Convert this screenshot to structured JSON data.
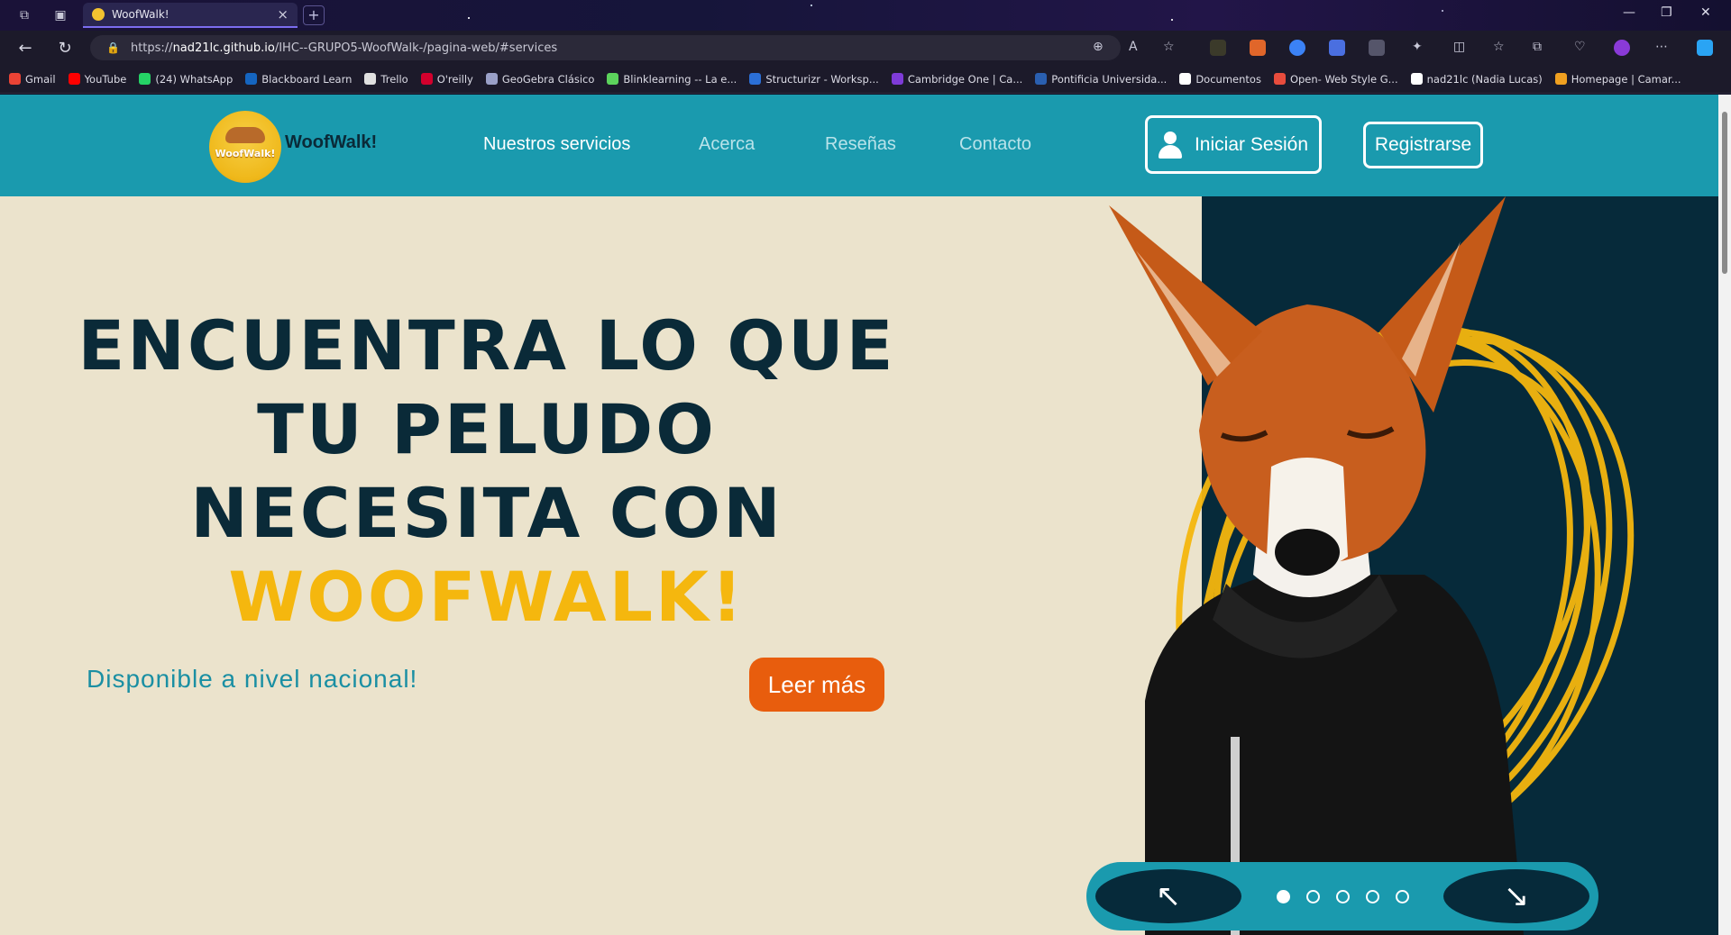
{
  "browser": {
    "tab_title": "WoofWalk!",
    "url_prefix": "https://",
    "url_host": "nad21lc.github.io",
    "url_path": "/IHC--GRUPO5-WoofWalk-/pagina-web/#services"
  },
  "bookmarks": [
    {
      "label": "Gmail",
      "color": "#ea4335"
    },
    {
      "label": "YouTube",
      "color": "#ff0000"
    },
    {
      "label": "(24) WhatsApp",
      "color": "#25d366"
    },
    {
      "label": "Blackboard Learn",
      "color": "#1565c0"
    },
    {
      "label": "Trello",
      "color": "#e0e0e0"
    },
    {
      "label": "O'reilly",
      "color": "#d3002d"
    },
    {
      "label": "GeoGebra Clásico",
      "color": "#9aa0c8"
    },
    {
      "label": "Blinklearning -- La e...",
      "color": "#5cd35c"
    },
    {
      "label": "Structurizr - Worksp...",
      "color": "#2b6fd6"
    },
    {
      "label": "Cambridge One | Ca...",
      "color": "#7e3bd8"
    },
    {
      "label": "Pontificia Universida...",
      "color": "#2a5fb0"
    },
    {
      "label": "Documentos",
      "color": "#ffffff"
    },
    {
      "label": "Open- Web Style G...",
      "color": "#e84c3d"
    },
    {
      "label": "nad21lc (Nadia Lucas)",
      "color": "#ffffff"
    },
    {
      "label": "Homepage | Camar...",
      "color": "#f0a020"
    }
  ],
  "site": {
    "brand": "WoofWalk!",
    "logo_text": "WoofWalk!",
    "nav": [
      {
        "label": "Nuestros servicios",
        "active": true
      },
      {
        "label": "Acerca",
        "active": false
      },
      {
        "label": "Reseñas",
        "active": false
      },
      {
        "label": "Contacto",
        "active": false
      }
    ],
    "login_label": "Iniciar Sesión",
    "register_label": "Registrarse"
  },
  "hero": {
    "heading_lines": [
      "ENCUENTRA LO QUE",
      "TU PELUDO",
      "NECESITA CON"
    ],
    "heading_accent": "WOOFWALK!",
    "subtitle": "Disponible a nivel nacional!",
    "cta_label": "Leer más",
    "carousel": {
      "prev_icon": "↖",
      "next_icon": "↘",
      "slide_count": 5,
      "active_index": 0
    }
  },
  "colors": {
    "nav_bg": "#1a9aae",
    "hero_bg": "#ebe3cc",
    "dark_panel": "#062a3a",
    "accent_yellow": "#f5b70e",
    "cta_orange": "#e85d0d"
  }
}
